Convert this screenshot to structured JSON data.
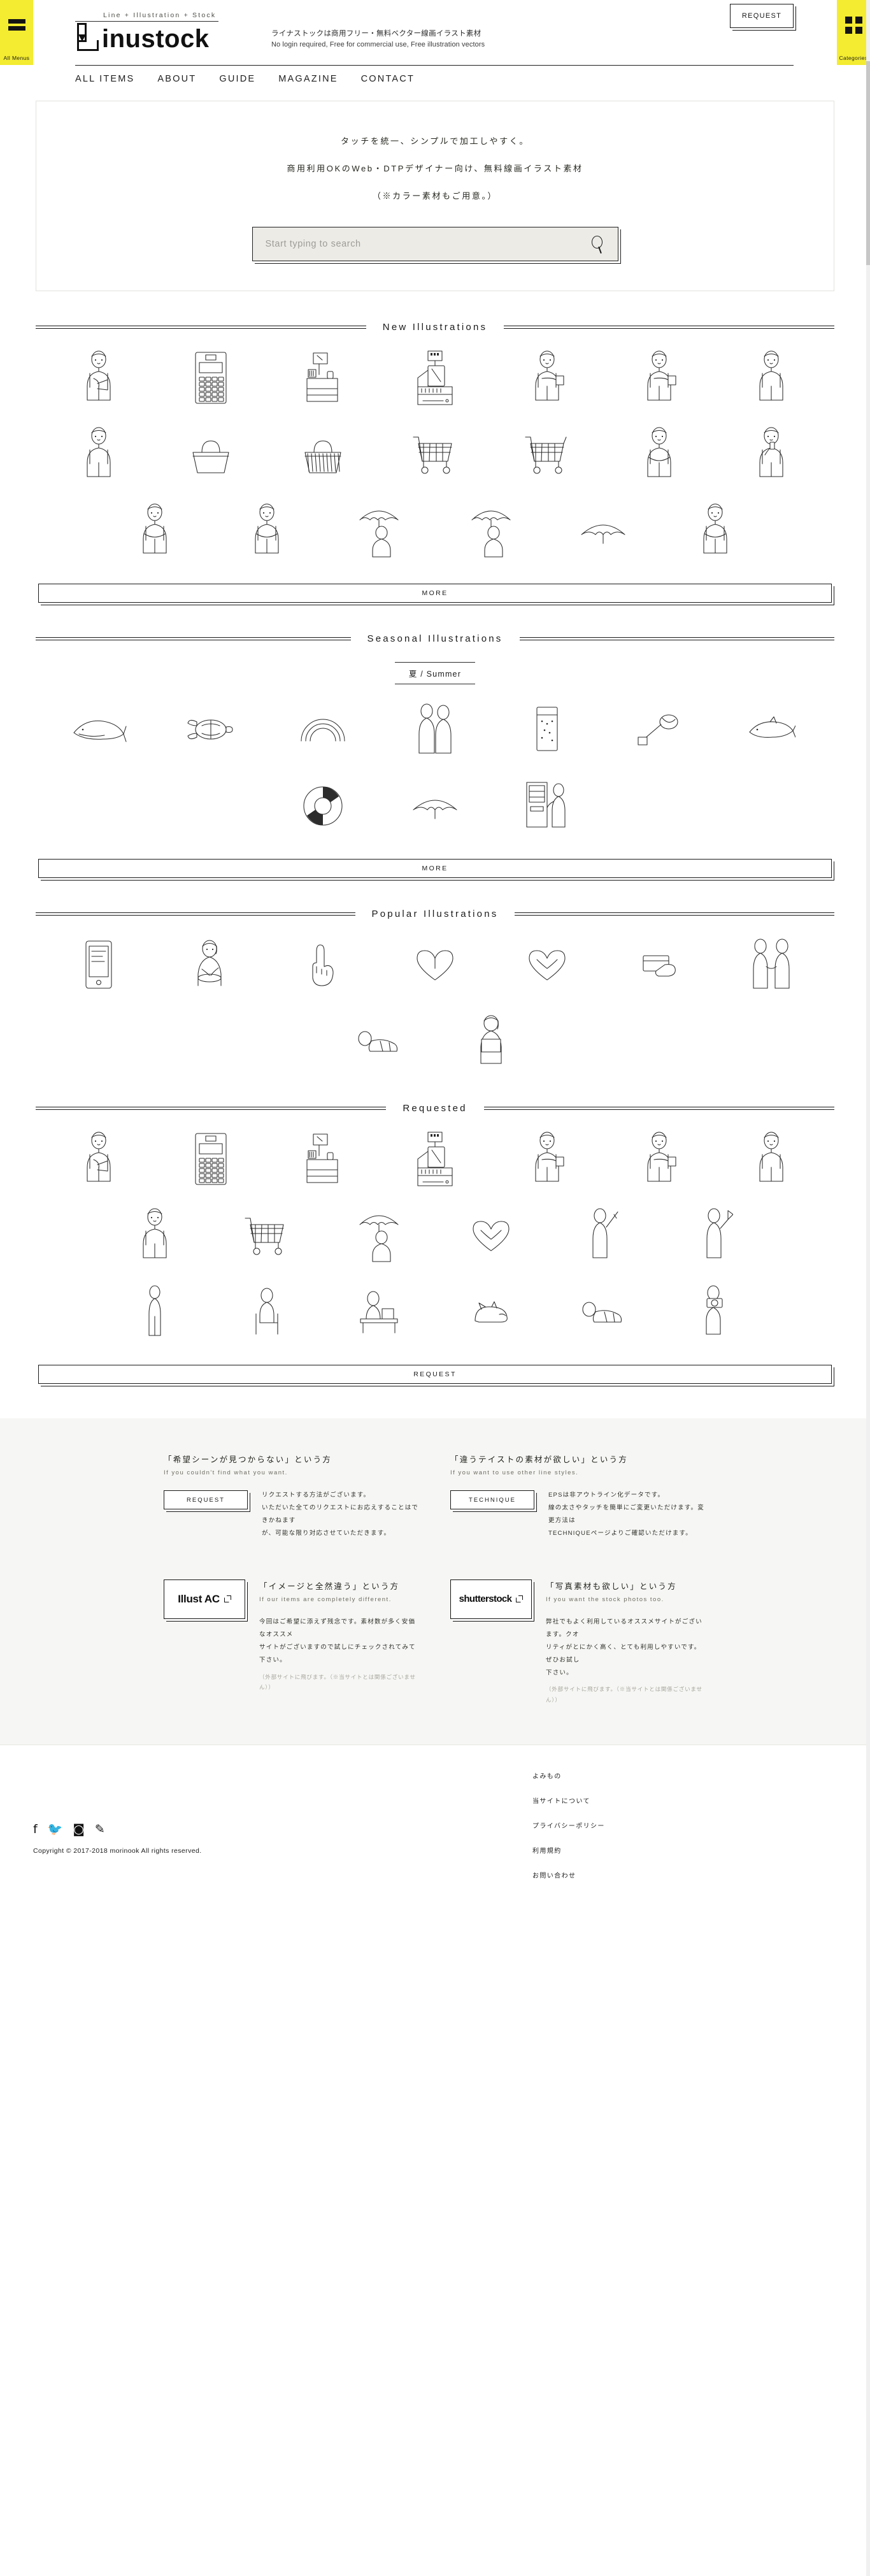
{
  "rails": {
    "left_label": "All Menus",
    "right_label": "Categories",
    "accent": "#f3ec30"
  },
  "header": {
    "logo_tagline": "Line + Illustration + Stock",
    "logo_text": "inustock",
    "desc_jp": "ライナストックは商用フリー・無料ベクター線画イラスト素材",
    "desc_en": "No login required, Free for commercial use, Free illustration vectors",
    "request_label": "REQUEST",
    "nav": [
      {
        "label": "ALL ITEMS"
      },
      {
        "label": "ABOUT"
      },
      {
        "label": "GUIDE"
      },
      {
        "label": "MAGAZINE"
      },
      {
        "label": "CONTACT"
      }
    ]
  },
  "hero": {
    "line1": "タッチを統一、シンプルで加工しやすく。",
    "line2": "商用利用OKのWeb・DTPデザイナー向け、無料線画イラスト素材",
    "line3": "（※カラー素材もご用意。）",
    "search_placeholder": "Start typing to search",
    "search_value": "",
    "search_icon": "magnifier-icon"
  },
  "sections": [
    {
      "id": "new",
      "title": "New Illustrations",
      "more_label": "MORE",
      "rows": [
        [
          "person-holding-calculator",
          "calculator-device",
          "pos-terminal-small",
          "cash-register",
          "man-holding-card",
          "woman-holding-card",
          "man-standing-hands-front"
        ],
        [
          "woman-standing",
          "shopping-basket",
          "shopping-basket-wire",
          "shopping-cart",
          "shopping-cart-side",
          "woman-thinking",
          "woman-phone-call"
        ],
        [
          "woman-arms-crossed",
          "woman-thinking-pose",
          "woman-with-umbrella",
          "person-with-umbrella",
          "beach-parasol",
          "person-crouching"
        ]
      ]
    },
    {
      "id": "seasonal",
      "title": "Seasonal Illustrations",
      "subtitle": "夏 / Summer",
      "more_label": "MORE",
      "rows": [
        [
          "whale",
          "sea-turtle",
          "rainbow",
          "couple-yukata",
          "shaved-ice-bag",
          "butterfly-net",
          "dolphin"
        ],
        [
          "lifebuoy",
          "beach-parasol",
          "vending-machine-person"
        ]
      ]
    },
    {
      "id": "popular",
      "title": "Popular Illustrations",
      "rows": [
        [
          "tablet-device",
          "woman-eating",
          "hand-pointing",
          "heart-hands",
          "heart-hands-two",
          "hand-holding-card",
          "couple-holding-hands"
        ],
        [
          "person-lying-down",
          "woman-holding-sign"
        ]
      ]
    },
    {
      "id": "requested",
      "title": "Requested",
      "more_label": "REQUEST",
      "rows": [
        [
          "person-holding-calculator",
          "calculator-device",
          "pos-terminal-small",
          "cash-register",
          "man-holding-card",
          "woman-holding-card",
          "man-standing-hands-front"
        ],
        [
          "woman-standing",
          "person-with-cart",
          "person-with-umbrella",
          "heart-hands-two",
          "person-with-rifle",
          "person-with-flag"
        ],
        [
          "person-standing-tall",
          "person-sitting-chair",
          "person-at-desk",
          "sleeping-cat",
          "person-lying",
          "person-with-camera"
        ]
      ]
    }
  ],
  "cta": {
    "cards": [
      {
        "id": "request",
        "heading_jp": "「希望シーンが見つからない」という方",
        "heading_en": "If you couldn't find what you want.",
        "body": [
          "リクエストする方法がございます。",
          "いただいた全てのリクエストにお応えすることはできかねます",
          "が、可能な限り対応させていただきます。"
        ],
        "button_label": "REQUEST",
        "note": ""
      },
      {
        "id": "technique",
        "heading_jp": "「違うテイストの素材が欲しい」という方",
        "heading_en": "If you want to use other line styles.",
        "body": [
          "EPSは非アウトライン化データです。",
          "線の太さやタッチを簡単にご変更いただけます。変更方法は",
          "TECHNIQUEページよりご確認いただけます。"
        ],
        "button_label": "TECHNIQUE",
        "note": ""
      },
      {
        "id": "illustac",
        "heading_jp": "「イメージと全然違う」という方",
        "heading_en": "If our items are completely different.",
        "body": [
          "今回はご希望に添えず残念です。素材数が多く安価なオススメ",
          "サイトがございますので試しにチェックされてみて下さい。"
        ],
        "logo_label": "Illust AC",
        "note": "（外部サイトに飛びます。（※当サイトとは関係ございません））"
      },
      {
        "id": "shutterstock",
        "heading_jp": "「写真素材も欲しい」という方",
        "heading_en": "If you want the stock photos too.",
        "body": [
          "弊社でもよく利用しているオススメサイトがございます。クオ",
          "リティがとにかく高く、とても利用しやすいです。ぜひお試し",
          "下さい。"
        ],
        "logo_label": "shutterstock",
        "note": "（外部サイトに飛びます。（※当サイトとは関係ございません））"
      }
    ]
  },
  "footer": {
    "links": [
      {
        "label": "よみもの"
      },
      {
        "label": "当サイトについて"
      },
      {
        "label": "プライバシーポリシー"
      },
      {
        "label": "利用規約"
      },
      {
        "label": "お問い合わせ"
      }
    ],
    "social": [
      {
        "name": "facebook-icon",
        "glyph": "f"
      },
      {
        "name": "twitter-icon",
        "glyph": "🐦"
      },
      {
        "name": "instagram-icon",
        "glyph": "◙"
      },
      {
        "name": "pen-icon",
        "glyph": "✎"
      }
    ],
    "copyright": "Copyright © 2017-2018 morinook All rights reserved."
  }
}
